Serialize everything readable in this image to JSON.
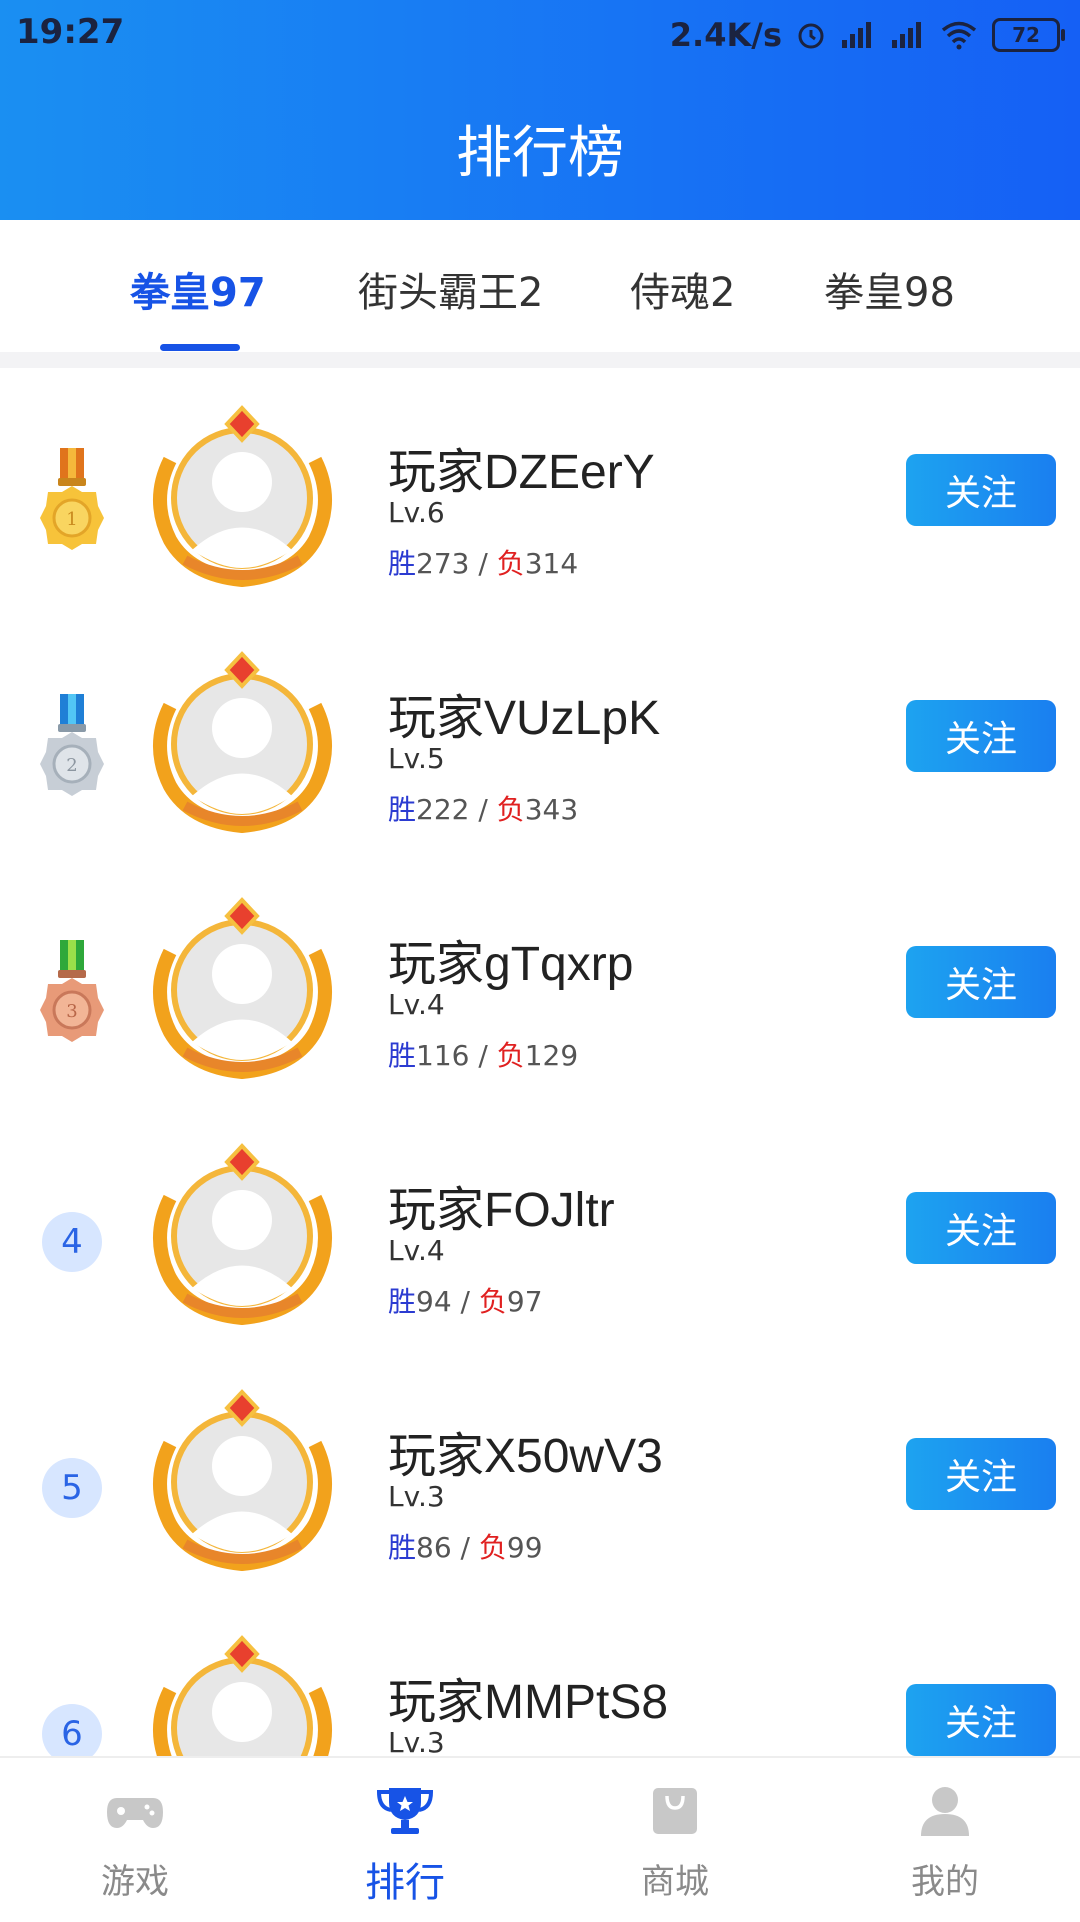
{
  "status_bar": {
    "time": "19:27",
    "network_speed": "2.4K/s",
    "battery": "72"
  },
  "header": {
    "title": "排行榜"
  },
  "tabs": [
    {
      "label": "拳皇97",
      "active": true
    },
    {
      "label": "街头霸王2",
      "active": false
    },
    {
      "label": "侍魂2",
      "active": false
    },
    {
      "label": "拳皇98",
      "active": false
    }
  ],
  "players": [
    {
      "rank": "1",
      "rank_style": "gold-medal",
      "name": "玩家DZEerY",
      "level": "Lv.6",
      "win_label": "胜",
      "wins": "273",
      "sep": " / ",
      "loss_label": "负",
      "losses": "314",
      "follow": "关注"
    },
    {
      "rank": "2",
      "rank_style": "silver-medal",
      "name": "玩家VUzLpK",
      "level": "Lv.5",
      "win_label": "胜",
      "wins": "222",
      "sep": " / ",
      "loss_label": "负",
      "losses": "343",
      "follow": "关注"
    },
    {
      "rank": "3",
      "rank_style": "bronze-medal",
      "name": "玩家gTqxrp",
      "level": "Lv.4",
      "win_label": "胜",
      "wins": "116",
      "sep": " / ",
      "loss_label": "负",
      "losses": "129",
      "follow": "关注"
    },
    {
      "rank": "4",
      "rank_style": "number",
      "name": "玩家FOJltr",
      "level": "Lv.4",
      "win_label": "胜",
      "wins": "94",
      "sep": " / ",
      "loss_label": "负",
      "losses": "97",
      "follow": "关注"
    },
    {
      "rank": "5",
      "rank_style": "number",
      "name": "玩家X50wV3",
      "level": "Lv.3",
      "win_label": "胜",
      "wins": "86",
      "sep": " / ",
      "loss_label": "负",
      "losses": "99",
      "follow": "关注"
    },
    {
      "rank": "6",
      "rank_style": "number",
      "name": "玩家MMPtS8",
      "level": "Lv.3",
      "win_label": "胜",
      "wins": "",
      "sep": "",
      "loss_label": "",
      "losses": "",
      "follow": "关注"
    }
  ],
  "bottom_nav": [
    {
      "label": "游戏",
      "icon": "gamepad-icon",
      "active": false
    },
    {
      "label": "排行",
      "icon": "trophy-icon",
      "active": true
    },
    {
      "label": "商城",
      "icon": "shopping-bag-icon",
      "active": false
    },
    {
      "label": "我的",
      "icon": "user-icon",
      "active": false
    }
  ],
  "colors": {
    "header_start": "#1a8ff2",
    "header_end": "#1560f5",
    "accent": "#1753e6",
    "win": "#2b3bd1",
    "loss": "#e02020",
    "follow_button": "#1a8ff0"
  }
}
